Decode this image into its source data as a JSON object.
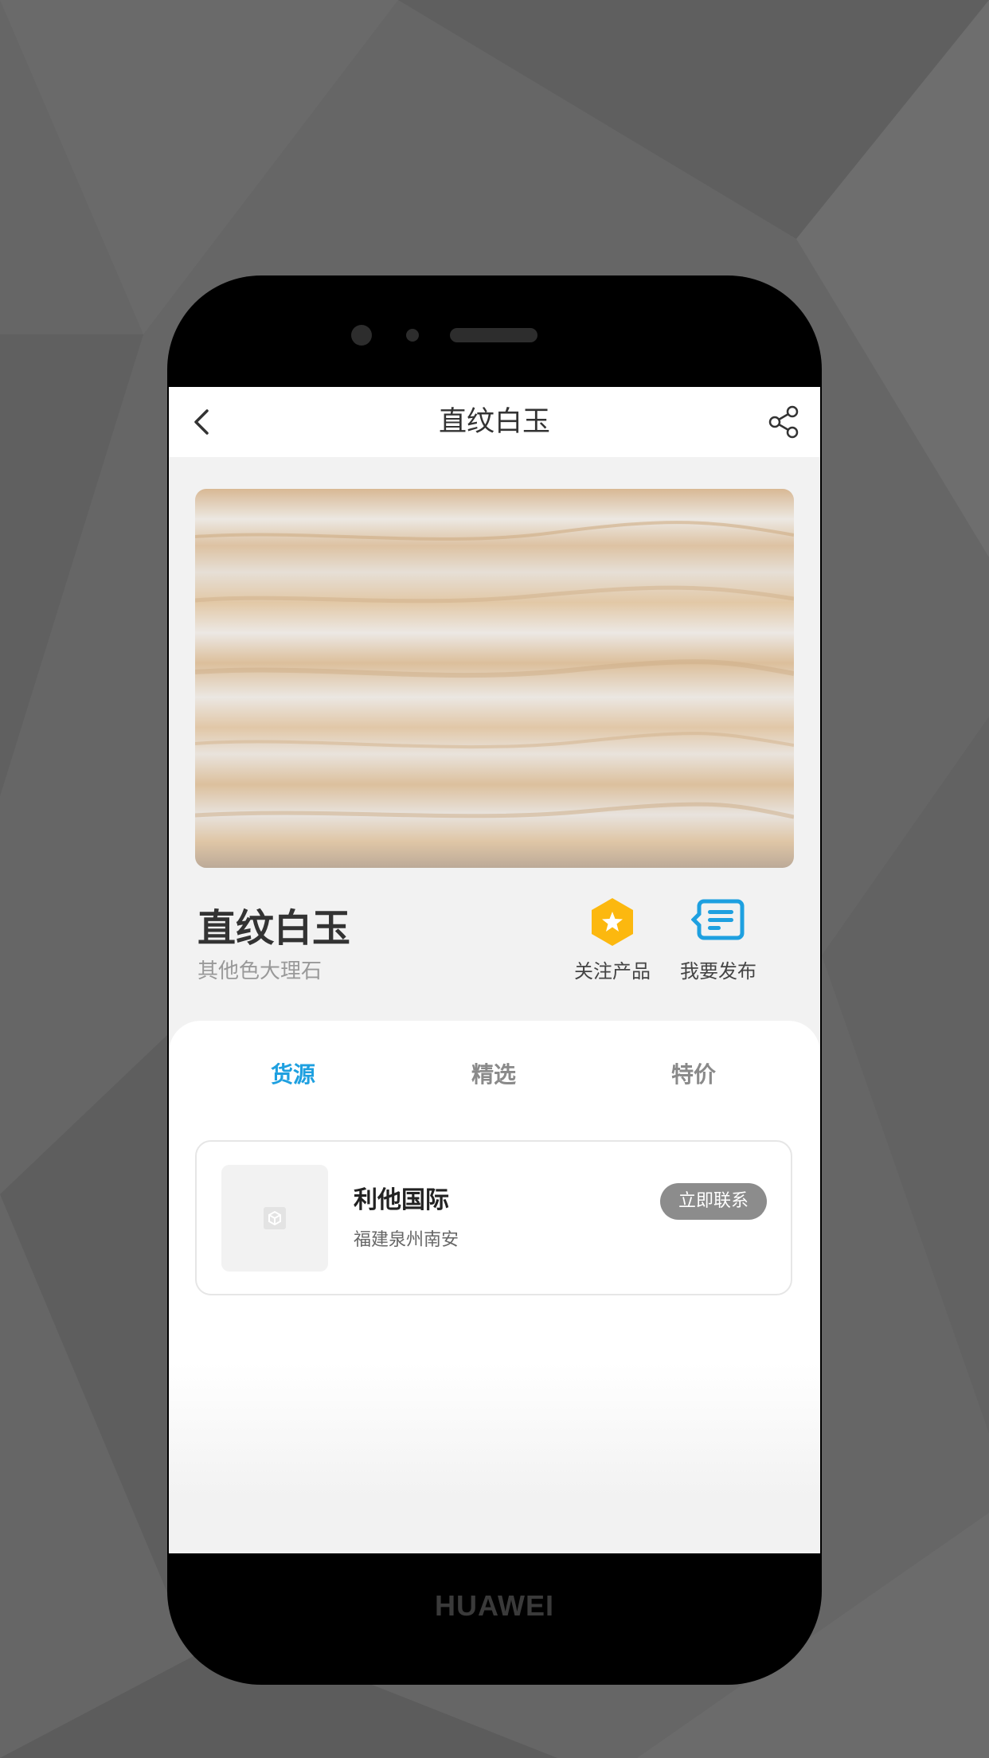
{
  "header": {
    "title": "直纹白玉",
    "back_icon": "chevron-left-icon",
    "share_icon": "share-icon"
  },
  "product": {
    "name": "直纹白玉",
    "category": "其他色大理石"
  },
  "actions": [
    {
      "label": "关注产品",
      "icon": "star-hexagon-icon",
      "color": "#fcb80f"
    },
    {
      "label": "我要发布",
      "icon": "message-list-icon",
      "color": "#1ea0e0"
    }
  ],
  "tabs": [
    {
      "label": "货源",
      "active": true
    },
    {
      "label": "精选",
      "active": false
    },
    {
      "label": "特价",
      "active": false
    }
  ],
  "suppliers": [
    {
      "name": "利他国际",
      "location": "福建泉州南安",
      "button": "立即联系"
    }
  ],
  "device": {
    "brand": "HUAWEI"
  },
  "colors": {
    "accent": "#1ea0e0",
    "star": "#fcb80f",
    "button_gray": "#8c8c8c",
    "background": "#f2f2f2"
  }
}
